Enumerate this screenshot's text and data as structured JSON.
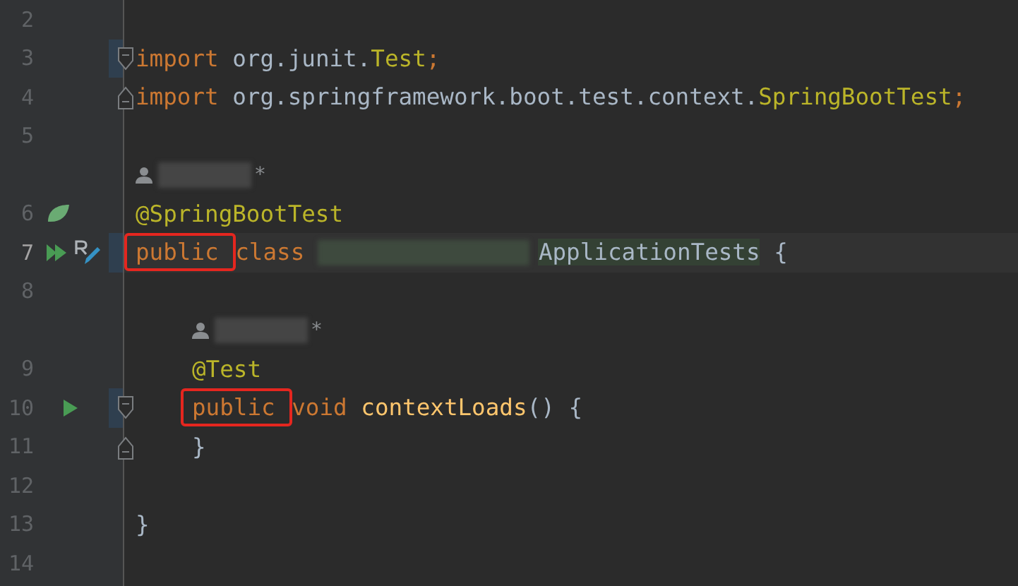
{
  "editor": {
    "lines": [
      {
        "kind": "code",
        "number": "2"
      },
      {
        "kind": "code",
        "number": "3",
        "marker": true,
        "fold_start": true,
        "tokens": [
          {
            "kind": "keyword",
            "text": "import "
          },
          {
            "kind": "plain",
            "text": "org.junit."
          },
          {
            "kind": "class",
            "text": "Test"
          },
          {
            "kind": "keyword",
            "text": ";"
          }
        ]
      },
      {
        "kind": "code",
        "number": "4",
        "fold_end": true,
        "tokens": [
          {
            "kind": "keyword",
            "text": "import "
          },
          {
            "kind": "plain",
            "text": "org.springframework.boot.test.context."
          },
          {
            "kind": "class",
            "text": "SpringBootTest"
          },
          {
            "kind": "keyword",
            "text": ";"
          }
        ]
      },
      {
        "kind": "code",
        "number": "5"
      },
      {
        "kind": "hint",
        "text": "*"
      },
      {
        "kind": "code",
        "number": "6",
        "gutter": [
          {
            "kind": "leaf"
          }
        ],
        "tokens": [
          {
            "kind": "annotation",
            "text": "@SpringBootTest"
          }
        ]
      },
      {
        "kind": "code",
        "number": "7",
        "current": true,
        "marker": true,
        "gutter": [
          {
            "kind": "run-all"
          },
          {
            "kind": "edit"
          }
        ],
        "tokens": [
          {
            "kind": "keyword",
            "text": "public ",
            "boxed": true
          },
          {
            "kind": "keyword",
            "text": "class "
          },
          {
            "kind": "redacted",
            "marked": true
          },
          {
            "kind": "plain",
            "text": "ApplicationTests",
            "marked": true
          },
          {
            "kind": "plain",
            "text": " {"
          }
        ]
      },
      {
        "kind": "code",
        "number": "8"
      },
      {
        "kind": "hint",
        "indented": true,
        "text": "*"
      },
      {
        "kind": "code",
        "number": "9",
        "indented": true,
        "tokens": [
          {
            "kind": "annotation",
            "text": "@Test"
          }
        ]
      },
      {
        "kind": "code",
        "number": "10",
        "marker": true,
        "fold_start": true,
        "indented": true,
        "gutter": [
          {
            "kind": "run"
          }
        ],
        "tokens": [
          {
            "kind": "keyword",
            "text": "public ",
            "boxed": true
          },
          {
            "kind": "keyword",
            "text": "void "
          },
          {
            "kind": "method",
            "text": "contextLoads"
          },
          {
            "kind": "plain",
            "text": "() {"
          }
        ]
      },
      {
        "kind": "code",
        "number": "11",
        "fold_end": true,
        "indented": true,
        "tokens": [
          {
            "kind": "plain",
            "text": "}"
          }
        ]
      },
      {
        "kind": "code",
        "number": "12"
      },
      {
        "kind": "code",
        "number": "13",
        "tokens": [
          {
            "kind": "plain",
            "text": "}"
          }
        ]
      },
      {
        "kind": "code",
        "number": "14"
      }
    ]
  }
}
